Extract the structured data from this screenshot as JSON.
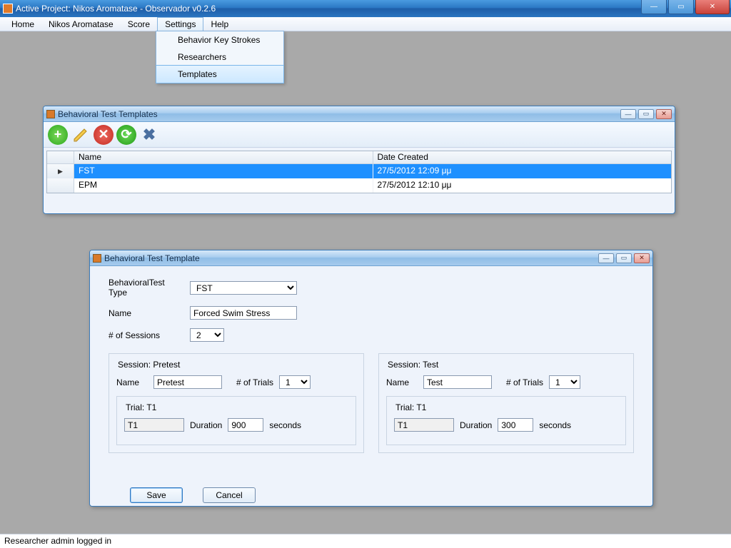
{
  "window": {
    "title": "Active Project: Nikos Aromatase - Observador v0.2.6"
  },
  "menubar": {
    "items": [
      "Home",
      "Nikos Aromatase",
      "Score",
      "Settings",
      "Help"
    ],
    "open_index": 3,
    "dropdown": {
      "items": [
        "Behavior Key Strokes",
        "Researchers",
        "Templates"
      ],
      "selected_index": 2
    }
  },
  "templates_window": {
    "title": "Behavioral Test Templates",
    "columns": {
      "name": "Name",
      "date": "Date Created"
    },
    "rows": [
      {
        "name": "FST",
        "date": "27/5/2012 12:09 μμ",
        "selected": true
      },
      {
        "name": "EPM",
        "date": "27/5/2012 12:10 μμ",
        "selected": false
      }
    ]
  },
  "form_window": {
    "title": "Behavioral Test Template",
    "labels": {
      "type": "BehavioralTest Type",
      "name": "Name",
      "sessions": "# of Sessions",
      "trials": "# of Trials",
      "duration": "Duration",
      "seconds": "seconds",
      "session_name": "Name"
    },
    "values": {
      "type": "FST",
      "name": "Forced Swim Stress",
      "sessions": "2"
    },
    "session1": {
      "legend": "Session: Pretest",
      "name": "Pretest",
      "trials": "1",
      "trial_legend": "Trial: T1",
      "trial_name": "T1",
      "duration": "900"
    },
    "session2": {
      "legend": "Session: Test",
      "name": "Test",
      "trials": "1",
      "trial_legend": "Trial: T1",
      "trial_name": "T1",
      "duration": "300"
    },
    "buttons": {
      "save": "Save",
      "cancel": "Cancel"
    }
  },
  "statusbar": "Researcher admin logged in",
  "icons": {
    "add": "+",
    "edit": "✎",
    "delete": "✕",
    "refresh": "⟳",
    "close": "✖",
    "min": "—",
    "max": "▭",
    "x": "✕"
  }
}
